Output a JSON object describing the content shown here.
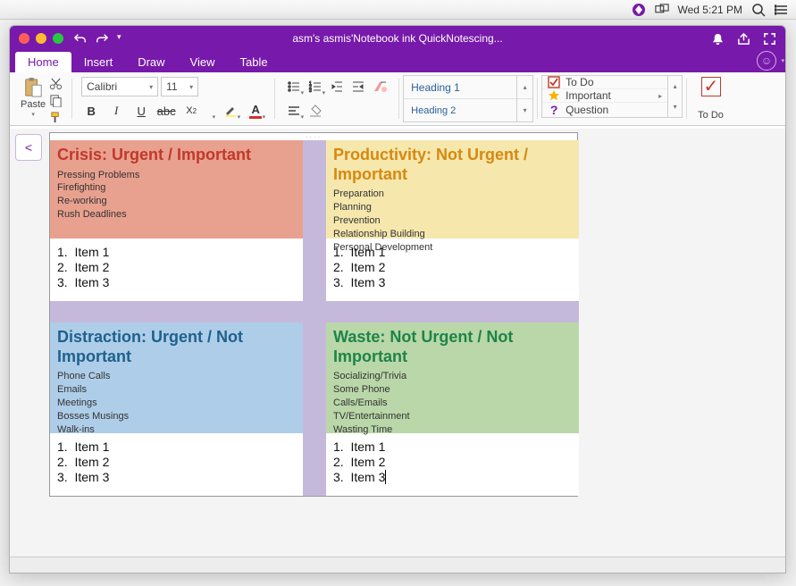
{
  "menubar": {
    "clock": "Wed 5:21 PM"
  },
  "window": {
    "title": "asm's asmis'Notebook ink QuickNotescing...",
    "tabs": [
      "Home",
      "Insert",
      "Draw",
      "View",
      "Table"
    ],
    "active_tab": "Home"
  },
  "ribbon": {
    "paste_label": "Paste",
    "font_family": "Calibri",
    "font_size": "11",
    "styles": [
      "Heading 1",
      "Heading 2"
    ],
    "tags": [
      {
        "icon": "checkbox",
        "label": "To Do"
      },
      {
        "icon": "star",
        "label": "Important"
      },
      {
        "icon": "question",
        "label": "Question"
      }
    ],
    "todo_label": "To Do"
  },
  "quadrants": {
    "q1": {
      "title": "Crisis: Urgent / Important",
      "examples": [
        "Pressing Problems",
        "Firefighting",
        "Re-working",
        "Rush Deadlines"
      ],
      "items": [
        "Item 1",
        "Item 2",
        "Item 3"
      ]
    },
    "q2": {
      "title": "Productivity: Not Urgent / Important",
      "examples": [
        "Preparation",
        "Planning",
        "Prevention",
        "Relationship Building",
        "Personal Development"
      ],
      "items": [
        "Item 1",
        "Item 2",
        "Item 3"
      ]
    },
    "q3": {
      "title": "Distraction: Urgent / Not Important",
      "examples": [
        "Phone Calls",
        "Emails",
        "Meetings",
        "Bosses Musings",
        "Walk-ins"
      ],
      "items": [
        "Item 1",
        "Item 2",
        "Item 3"
      ]
    },
    "q4": {
      "title": "Waste: Not Urgent / Not Important",
      "examples": [
        "Socializing/Trivia",
        "Some Phone",
        "Calls/Emails",
        "TV/Entertainment",
        "Wasting Time"
      ],
      "items": [
        "Item 1",
        "Item 2",
        "Item 3"
      ]
    }
  }
}
